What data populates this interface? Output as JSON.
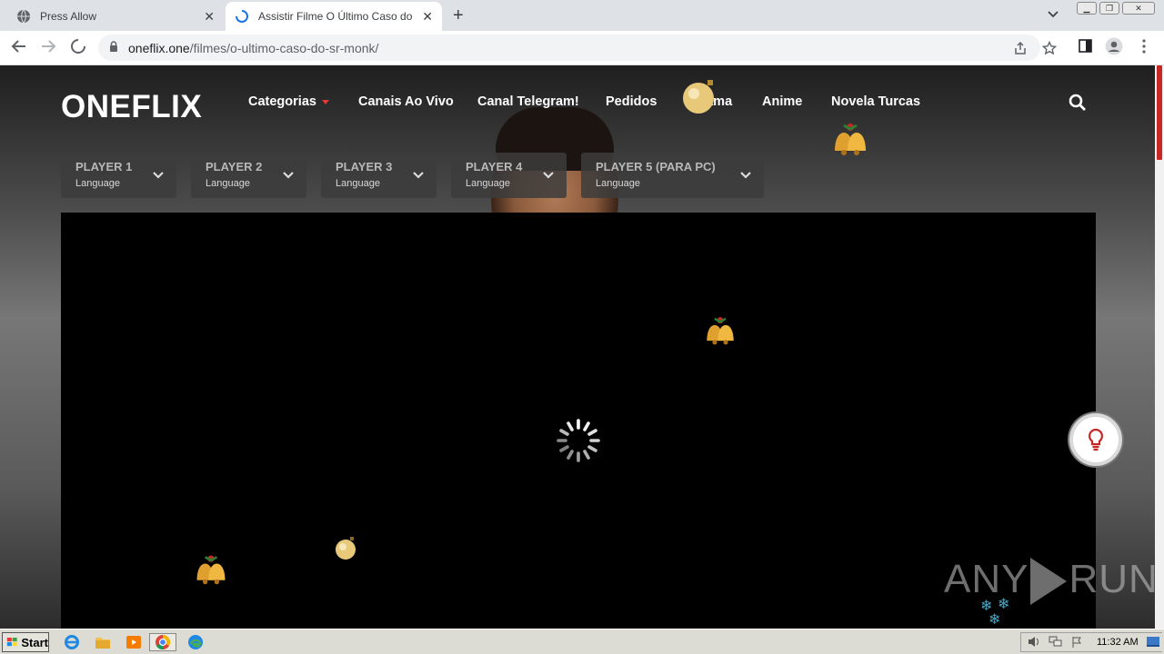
{
  "browser": {
    "tabs": [
      {
        "title": "Press Allow",
        "close": "✕"
      },
      {
        "title": "Assistir Filme O Último Caso do Sr. Monk",
        "close": "✕"
      }
    ],
    "new_tab": "+",
    "tab_dropdown": "⌄",
    "url_domain": "oneflix.one",
    "url_path": "/filmes/o-ultimo-caso-do-sr-monk/"
  },
  "site": {
    "logo": "ONEFLIX",
    "menu": [
      "Categorias",
      "Canais Ao Vivo",
      "Canal Telegram!",
      "Pedidos",
      "Drama",
      "Anime",
      "Novela Turcas"
    ],
    "players": [
      {
        "name": "PLAYER 1",
        "lang": "Language"
      },
      {
        "name": "PLAYER 2",
        "lang": "Language"
      },
      {
        "name": "PLAYER 3",
        "lang": "Language"
      },
      {
        "name": "PLAYER 4",
        "lang": "Language"
      },
      {
        "name": "PLAYER 5 (PARA PC)",
        "lang": "Language"
      }
    ],
    "accent_color": "#e53935"
  },
  "watermark": {
    "left": "ANY",
    "right": "RUN"
  },
  "taskbar": {
    "start": "Start",
    "clock": "11:32 AM"
  }
}
